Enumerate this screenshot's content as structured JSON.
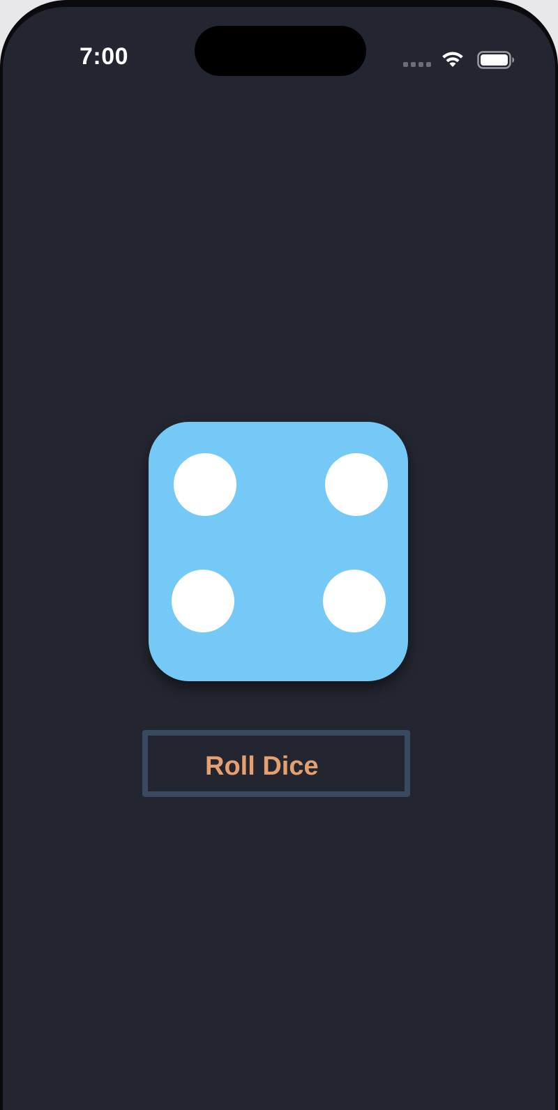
{
  "status_bar": {
    "time": "7:00",
    "wifi_icon": "wifi-icon",
    "battery_icon": "battery-icon",
    "signal_icon": "cellular-signal-icon"
  },
  "dice": {
    "face_value": 4,
    "color": "#74c9f6",
    "pip_color": "#ffffff"
  },
  "roll_button": {
    "label": "Roll Dice",
    "text_color": "#e4a16f",
    "border_color": "#384a5f"
  },
  "colors": {
    "background": "#232630",
    "frame": "#0b0b0d"
  }
}
